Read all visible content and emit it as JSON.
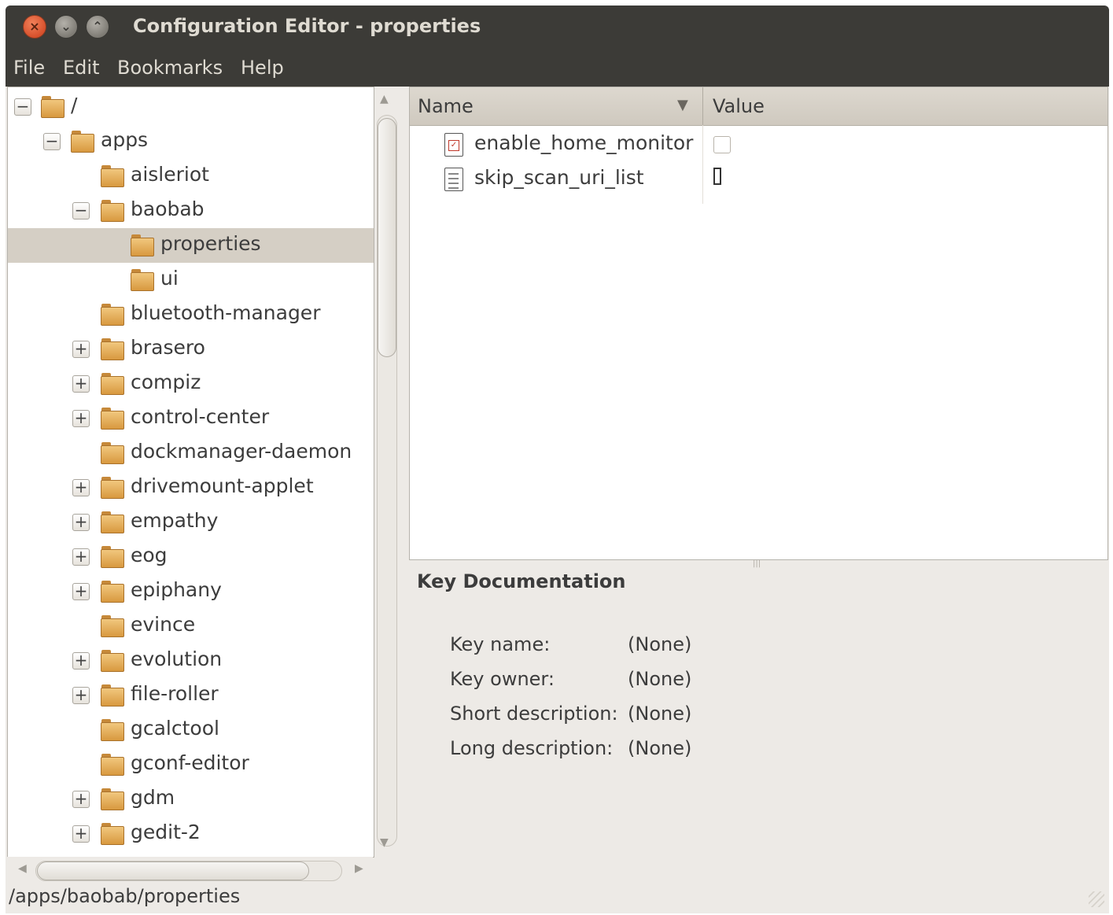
{
  "window": {
    "title": "Configuration Editor - properties",
    "buttons": {
      "close": "×",
      "minimize": "⌄",
      "maximize": "⌃"
    }
  },
  "menubar": {
    "items": [
      "File",
      "Edit",
      "Bookmarks",
      "Help"
    ]
  },
  "tree": {
    "nodes": [
      {
        "label": "/",
        "expander": "−"
      },
      {
        "label": "apps",
        "expander": "−"
      },
      {
        "label": "aisleriot",
        "expander": ""
      },
      {
        "label": "baobab",
        "expander": "−"
      },
      {
        "label": "properties",
        "expander": "",
        "selected": true
      },
      {
        "label": "ui",
        "expander": ""
      },
      {
        "label": "bluetooth-manager",
        "expander": ""
      },
      {
        "label": "brasero",
        "expander": "+"
      },
      {
        "label": "compiz",
        "expander": "+"
      },
      {
        "label": "control-center",
        "expander": "+"
      },
      {
        "label": "dockmanager-daemon",
        "expander": ""
      },
      {
        "label": "drivemount-applet",
        "expander": "+"
      },
      {
        "label": "empathy",
        "expander": "+"
      },
      {
        "label": "eog",
        "expander": "+"
      },
      {
        "label": "epiphany",
        "expander": "+"
      },
      {
        "label": "evince",
        "expander": ""
      },
      {
        "label": "evolution",
        "expander": "+"
      },
      {
        "label": "file-roller",
        "expander": "+"
      },
      {
        "label": "gcalctool",
        "expander": ""
      },
      {
        "label": "gconf-editor",
        "expander": ""
      },
      {
        "label": "gdm",
        "expander": "+"
      },
      {
        "label": "gedit-2",
        "expander": "+"
      }
    ]
  },
  "keys": {
    "columns": {
      "name": "Name",
      "value": "Value",
      "sort_indicator": "▼"
    },
    "rows": [
      {
        "name": "enable_home_monitor",
        "type_icon": "boolean-key-icon",
        "value_widget": "checkbox",
        "checked": false
      },
      {
        "name": "skip_scan_uri_list",
        "type_icon": "list-key-icon",
        "value_widget": "list",
        "value": "[]"
      }
    ]
  },
  "documentation": {
    "title": "Key Documentation",
    "fields": [
      {
        "label": "Key name:",
        "value": "(None)"
      },
      {
        "label": "Key owner:",
        "value": "(None)"
      },
      {
        "label": "Short description:",
        "value": "(None)"
      },
      {
        "label": "Long description:",
        "value": "(None)"
      }
    ]
  },
  "statusbar": {
    "path": "/apps/baobab/properties"
  },
  "colors": {
    "titlebar": "#3c3b37",
    "selection": "#d5cfc5",
    "window_bg": "#edeae6",
    "folder": "#e0a94f"
  }
}
